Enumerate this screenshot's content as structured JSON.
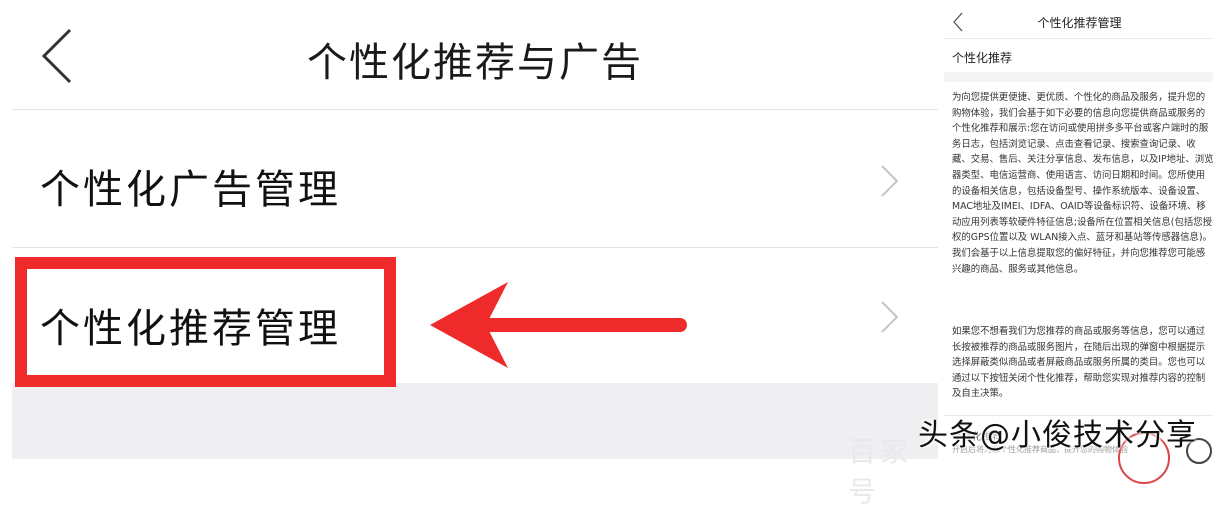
{
  "left_panel": {
    "title": "个性化推荐与广告",
    "items": [
      {
        "label": "个性化广告管理"
      },
      {
        "label": "个性化推荐管理"
      }
    ],
    "watermark": "百家号"
  },
  "right_panel": {
    "title": "个性化推荐管理",
    "section_title": "个性化推荐",
    "paragraph_1": "为向您提供更便捷、更优质、个性化的商品及服务，提升您的购物体验，我们会基于如下必要的信息向您提供商品或服务的个性化推荐和展示:您在访问或使用拼多多平台或客户端时的服务日志，包括浏览记录、点击查看记录、搜索查询记录、收藏、交易、售后、关注分享信息、发布信息，以及IP地址、浏览器类型、电信运营商、使用语言、访问日期和时间。您所使用的设备相关信息，包括设备型号、操作系统版本、设备设置、MAC地址及IMEI、IDFA、OAID等设备标识符、设备环境、移动应用列表等软硬件特征信息;设备所在位置相关信息(包括您授权的GPS位置以及 WLAN接入点、蓝牙和基站等传感器信息)。我们会基于以上信息提取您的偏好特征，并向您推荐您可能感兴趣的商品、服务或其他信息。",
    "paragraph_2": "如果您不想看我们为您推荐的商品或服务等信息，您可以通过长按被推荐的商品或服务图片，在随后出现的弹窗中根据提示选择屏蔽类似商品或者屏蔽商品或服务所属的类目。您也可以通过以下按钮关闭个性化推荐，帮助您实现对推荐内容的控制及自主决策。",
    "toggle_label": "个性化推荐",
    "toggle_sub": "开启后将为您个性化推荐商品，提升您的购物体验"
  },
  "overlay_text": "头条@小俊技术分享",
  "colors": {
    "highlight": "#ee2a2a",
    "divider": "#e3e3e3",
    "gray_background": "#efeff1"
  }
}
